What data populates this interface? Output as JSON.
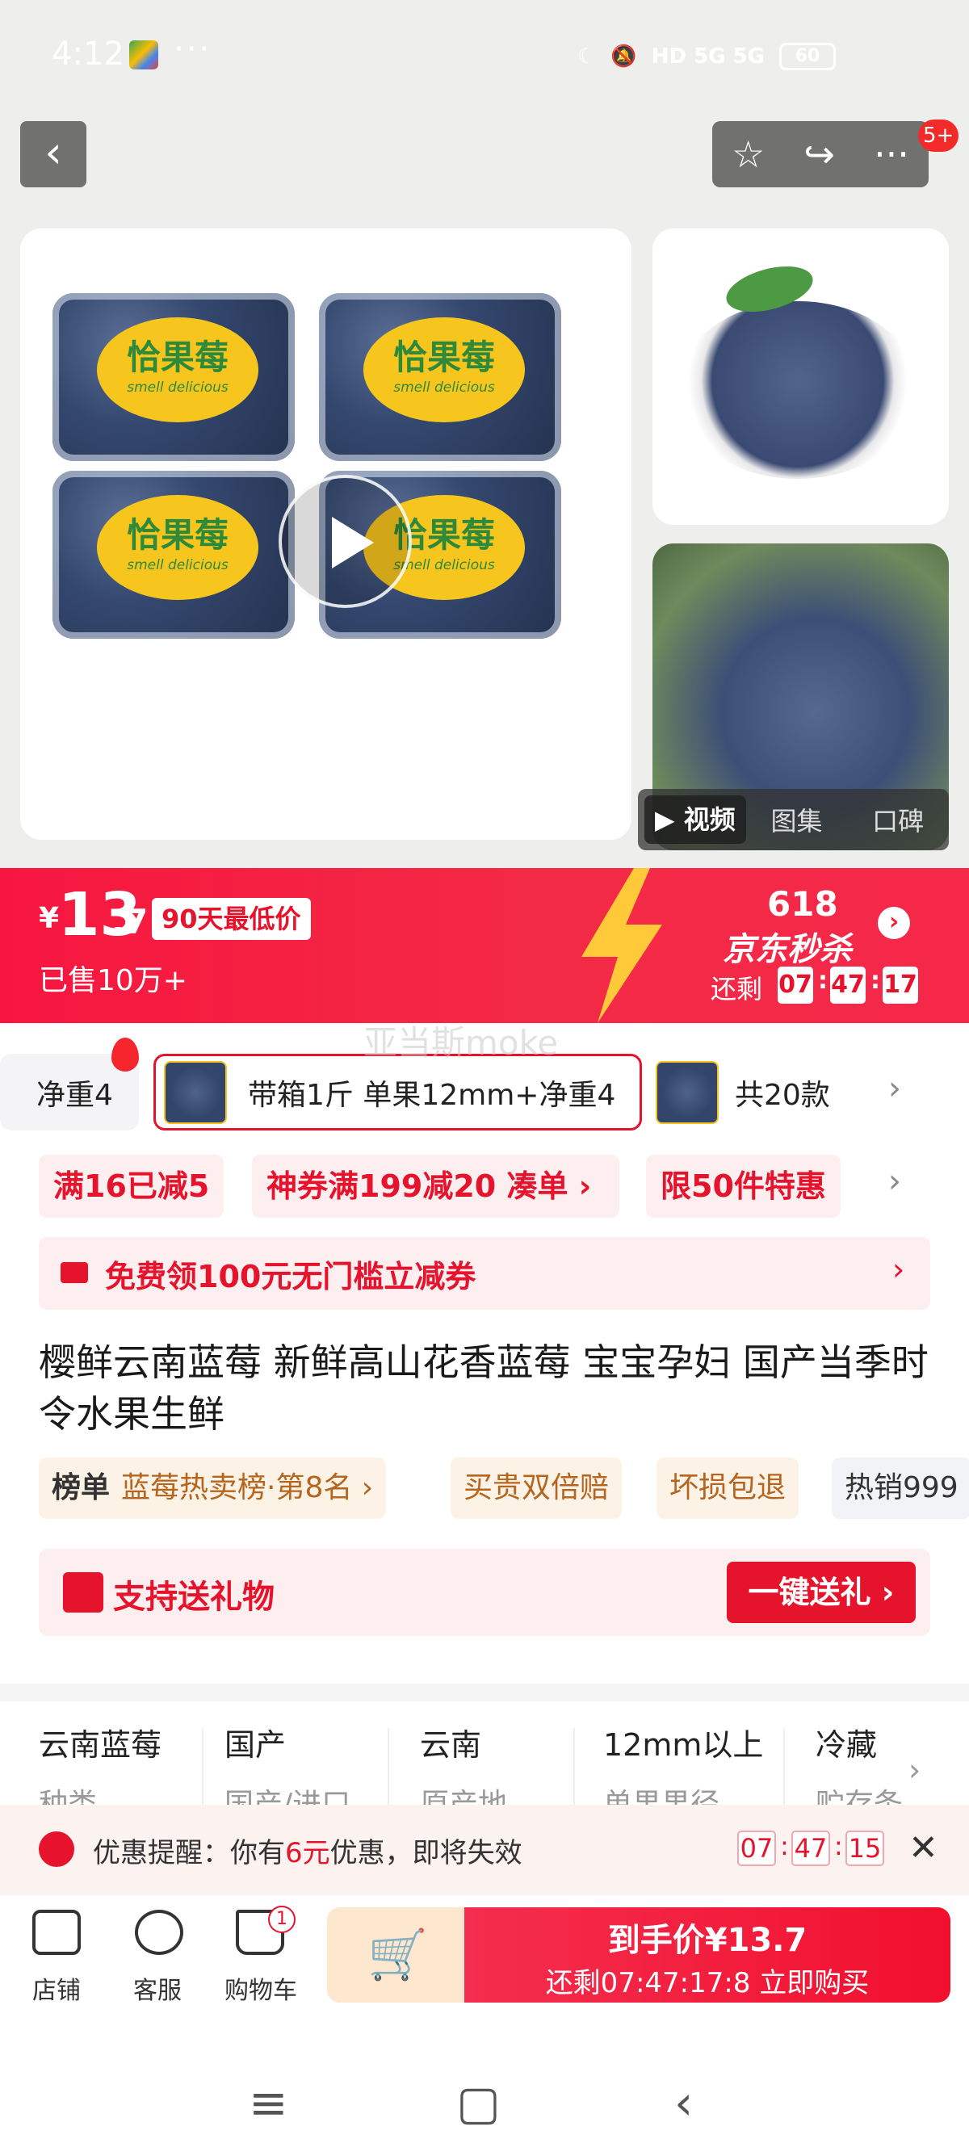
{
  "status": {
    "time": "4:12",
    "dots": "···",
    "network": "HD 5G 5G",
    "battery": "60"
  },
  "header": {
    "back_icon": "chevron-left-icon",
    "more_badge": "5+"
  },
  "media": {
    "tabs": [
      "视频",
      "图集",
      "口碑"
    ],
    "brand_label": "恰果莓",
    "brand_sub": "smell delicious"
  },
  "price": {
    "yen": "¥",
    "main": "13",
    "decimal": ".7",
    "lowest_tag": "90天最低价",
    "sold": "已售10万+"
  },
  "promo": {
    "event": "618",
    "name": "京东秒杀",
    "remain": "还剩",
    "hh": "07",
    "mm": "47",
    "ss": "17"
  },
  "watermark": "亚当斯moke",
  "specs": {
    "item1": "净重4",
    "item2": "带箱1斤 单果12mm+净重4",
    "item3": "共20款"
  },
  "coupons": [
    "满16已减5",
    "神券满199减20",
    "凑单 ›",
    "限50件特惠"
  ],
  "free_coupon": "免费领100元无门槛立减券",
  "title": "樱鲜云南蓝莓 新鲜高山花香蓝莓 宝宝孕妇  国产当季时令水果生鲜",
  "tags": {
    "rank_label": "榜单",
    "rank_text": "蓝莓热卖榜·第8名 ›",
    "t2": "买贵双倍赔",
    "t3": "坏损包退",
    "t4": "热销999"
  },
  "gift": {
    "text": "支持送礼物",
    "button": "一键送礼 ›"
  },
  "attributes": [
    {
      "value": "云南蓝莓",
      "label": "种类"
    },
    {
      "value": "国产",
      "label": "国产/进口"
    },
    {
      "value": "云南",
      "label": "原产地"
    },
    {
      "value": "12mm以上",
      "label": "单果果径"
    },
    {
      "value": "冷藏",
      "label": "贮存条"
    }
  ],
  "reminder": {
    "prefix": "优惠提醒：你有",
    "amount": "6元",
    "suffix": "优惠，即将失效",
    "hh": "07",
    "mm": "47",
    "ss": "15"
  },
  "bottom": {
    "shop": "店铺",
    "service": "客服",
    "cart": "购物车",
    "cart_count": "1",
    "buy_line1": "到手价¥13.7",
    "buy_line2": "还剩07:47:17:8  立即购买"
  },
  "colors": {
    "accent": "#e5132c",
    "banner": "#f32a45"
  }
}
